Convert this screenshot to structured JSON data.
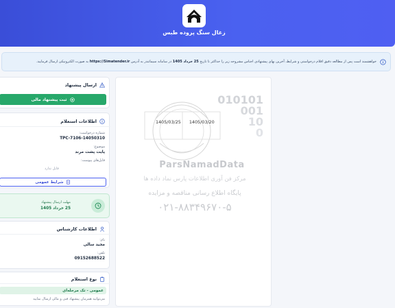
{
  "header": {
    "title": "زغال سنگ پروده طبس"
  },
  "notice": {
    "part1": "خواهشمند است پس از مطالعه دقیق اقلام درخواستی و شرایط، آخرین بهای پیشنهادی اجناس مشروحه زیر را حداکثر تا تاریخ",
    "deadline": "25 خرداد 1405",
    "part2": "در سامانه سیماتندر به آدرس",
    "url": "https://Simatender.ir",
    "part3": "به صورت الکترونیکی ارسال فرمایید."
  },
  "submit": {
    "title": "ارسال پیشنهاد",
    "button": "ثبت پیشنهاد مالی"
  },
  "request_info": {
    "title": "اطلاعات استعلام",
    "number_label": "شماره درخواست:",
    "number": "TPC-7106-14050310",
    "subject_label": "موضوع:",
    "subject": "پایت پشت مرند",
    "attachments_label": "فایل‌های پیوست:",
    "attachments_empty": "فایل ندارد",
    "terms_button": "شرایط عمومی"
  },
  "deadline_card": {
    "label": "مهلت ارسال پیشنهاد",
    "value": "25 خرداد 1405"
  },
  "expert": {
    "title": "اطلاعات کارشناس",
    "name_label": "نام:",
    "name": "مجید سالی",
    "phone_label": "تلفن:",
    "phone": "09152688522"
  },
  "inquiry_type": {
    "title": "نوع استعلام",
    "badge": "عمومی - تک مرحله‌ای",
    "desc": "می‌توانید همزمان پیشنهاد فنی و مالی ارسال نمایید"
  },
  "watermark": {
    "date1": "1405/03/25",
    "date2": "1405/03/20",
    "brand": "ParsNamadData",
    "line1": "مرکز فن آوری اطلاعات پارس نماد داده ها",
    "line2": "پایگاه اطلاع رسانی مناقصه و مزایده",
    "phone": "۰۲۱-۸۸۳۴۹۶۷۰-۵",
    "digits": "010101"
  },
  "colors": {
    "primary": "#4a5ff0",
    "success": "#27a86a",
    "notice_bg": "#e7f1fb"
  }
}
